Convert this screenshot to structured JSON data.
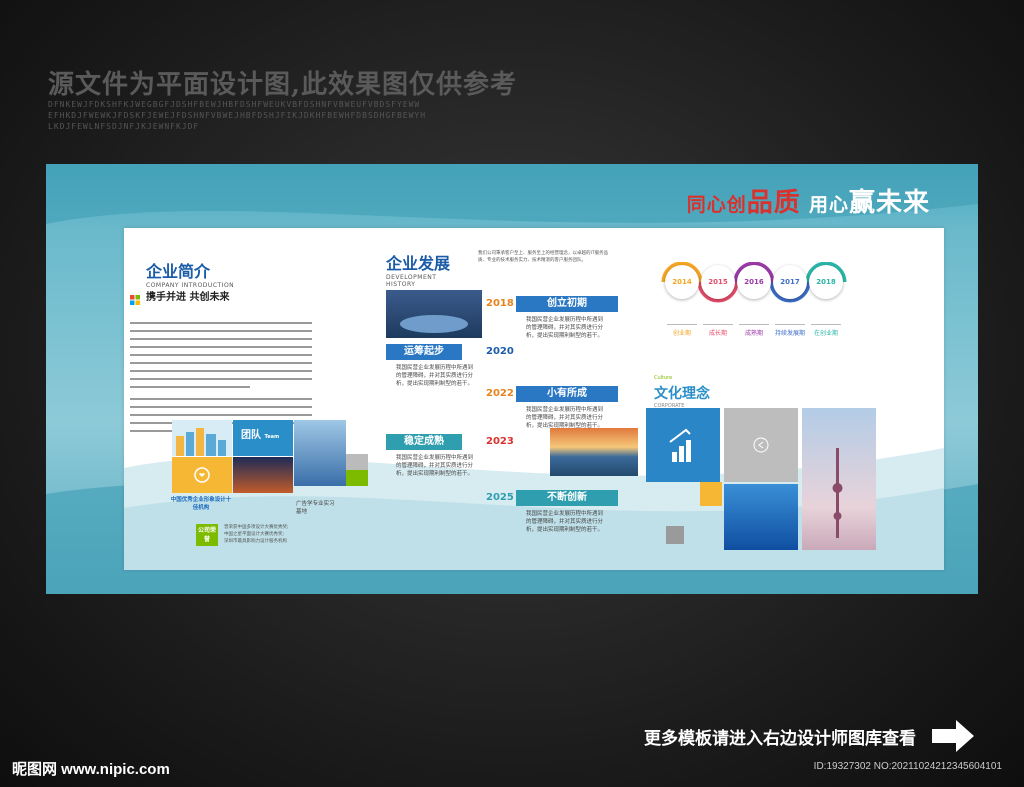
{
  "watermark": {
    "title": "源文件为平面设计图,此效果图仅供参考",
    "lines": [
      "DFNKEWJFDKSHFKJWEGBGFJDSHFBEWJHBFDSHFWEUKVBFDSHNFVBWEUFVBDSFYEWW",
      "EFHKDJFWEWKJFDSKFJEWEJFDSHNFVBWEJHBFDSHJFIKJDKHFBEWHFDBSDHGFBEWYH",
      "LKDJFEWLNFSDJNFJKJEWNFKJDF"
    ]
  },
  "slogan": {
    "part1": "同心创",
    "part2": "品质",
    "part3": "用心",
    "part4": "赢未来"
  },
  "intro": {
    "title": "企业简介",
    "subtitle": "COMPANY INTRODUCTION",
    "motto": "携手并进 共创未来",
    "team_label": "团队",
    "team_sub": "Team",
    "caption_1": "中国优秀企业形象设计十佳机构",
    "caption_2": "广告学专业实习基地",
    "honor_label": "公司荣誉",
    "honor_lines": [
      "曾荣获中国多项设计大赛优秀奖;",
      "中国之星平面设计大赛优秀奖;",
      "深圳市最具影响力设计服务机构"
    ]
  },
  "history": {
    "title": "企业发展",
    "subtitle": "DEVELOPMENT HISTORY",
    "desc": "我们公司秉承客户至上、服务至上的经营理念，以卓越的IT服务品质、专业的技术服务实力、技术精湛的客户服务团队。",
    "milestones": [
      {
        "year": "2018",
        "label": "创立初期"
      },
      {
        "year": "2020",
        "label": "运筹起步"
      },
      {
        "year": "2022",
        "label": "小有所成"
      },
      {
        "year": "2023",
        "label": "稳定成熟"
      },
      {
        "year": "2025",
        "label": "不断创新"
      }
    ],
    "item_text": "我国民营企业发展历程中所遇到的管理障碍，并对其实质进行分析，提出实现期利制型的若干。"
  },
  "timeline": {
    "years": [
      "2014",
      "2015",
      "2016",
      "2017",
      "2018"
    ],
    "colors": [
      "#f5a623",
      "#e84d6b",
      "#9b3aa8",
      "#3d6ec9",
      "#2bb5a8"
    ],
    "phases": [
      "创业期",
      "成长期",
      "成熟期",
      "持续发展期",
      "在创业期"
    ]
  },
  "culture": {
    "title": "文化理念",
    "tag": "Culture",
    "sub": "CORPORATE"
  },
  "footer": {
    "text": "更多模板请进入右边设计师图库查看",
    "logo": "昵图网 www.nipic.com",
    "id": "ID:19327302 NO:20211024212345604101"
  }
}
